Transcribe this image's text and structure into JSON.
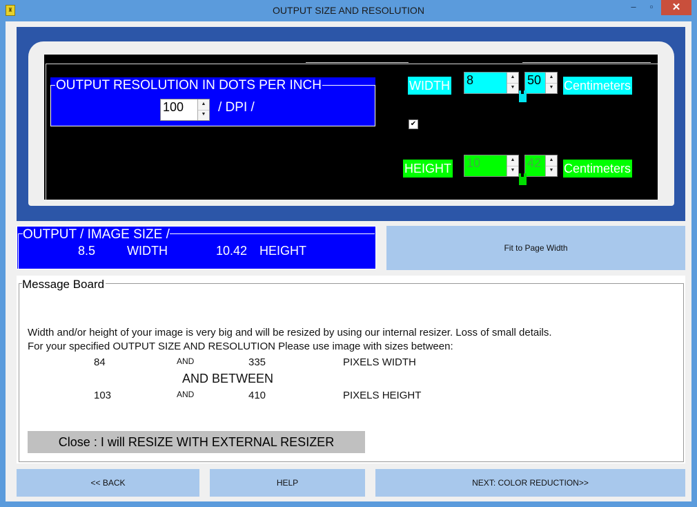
{
  "window": {
    "title": "OUTPUT SIZE AND RESOLUTION",
    "minimize_glyph": "‒",
    "maximize_glyph": "▫",
    "close_glyph": "✕"
  },
  "resolution": {
    "legend": "OUTPUT  RESOLUTION IN DOTS PER INCH",
    "dpi_value": "100",
    "unit": "/ DPI /"
  },
  "dimensions": {
    "width_label": "WIDTH",
    "width_whole": "8",
    "width_decimal": "50",
    "width_unit": "Centimeters",
    "keep_aspect_checked": "✔",
    "height_label": "HEIGHT",
    "height_whole": "10",
    "height_decimal": "42",
    "height_unit": "Centimeters"
  },
  "output_size": {
    "legend": "OUTPUT / IMAGE SIZE /",
    "width_value": "8.5",
    "width_label": "WIDTH",
    "height_value": "10.42",
    "height_label": "HEIGHT"
  },
  "fit_button": "Fit to Page Width",
  "message_board": {
    "legend": "Message Board",
    "text": "Width and/or height of your image is very big and will be resized by using our internal resizer. Loss of small details. For your specified OUTPUT SIZE AND RESOLUTION Please use  image with sizes between:",
    "min_width": "84",
    "and_1": "AND",
    "max_width": "335",
    "width_label": "PIXELS WIDTH",
    "between": "AND BETWEEN",
    "min_height": "103",
    "and_2": "AND",
    "max_height": "410",
    "height_label": "PIXELS HEIGHT",
    "close_button": "Close : I will RESIZE WITH EXTERNAL RESIZER"
  },
  "nav": {
    "back": "<< BACK",
    "help": "HELP",
    "next": "NEXT: COLOR REDUCTION>>"
  },
  "colors": {
    "frame_blue": "#2c56a8",
    "group_blue": "#0000ff",
    "cyan": "#00ffff",
    "green": "#00ff00",
    "button_blue": "#a8c8ec"
  }
}
